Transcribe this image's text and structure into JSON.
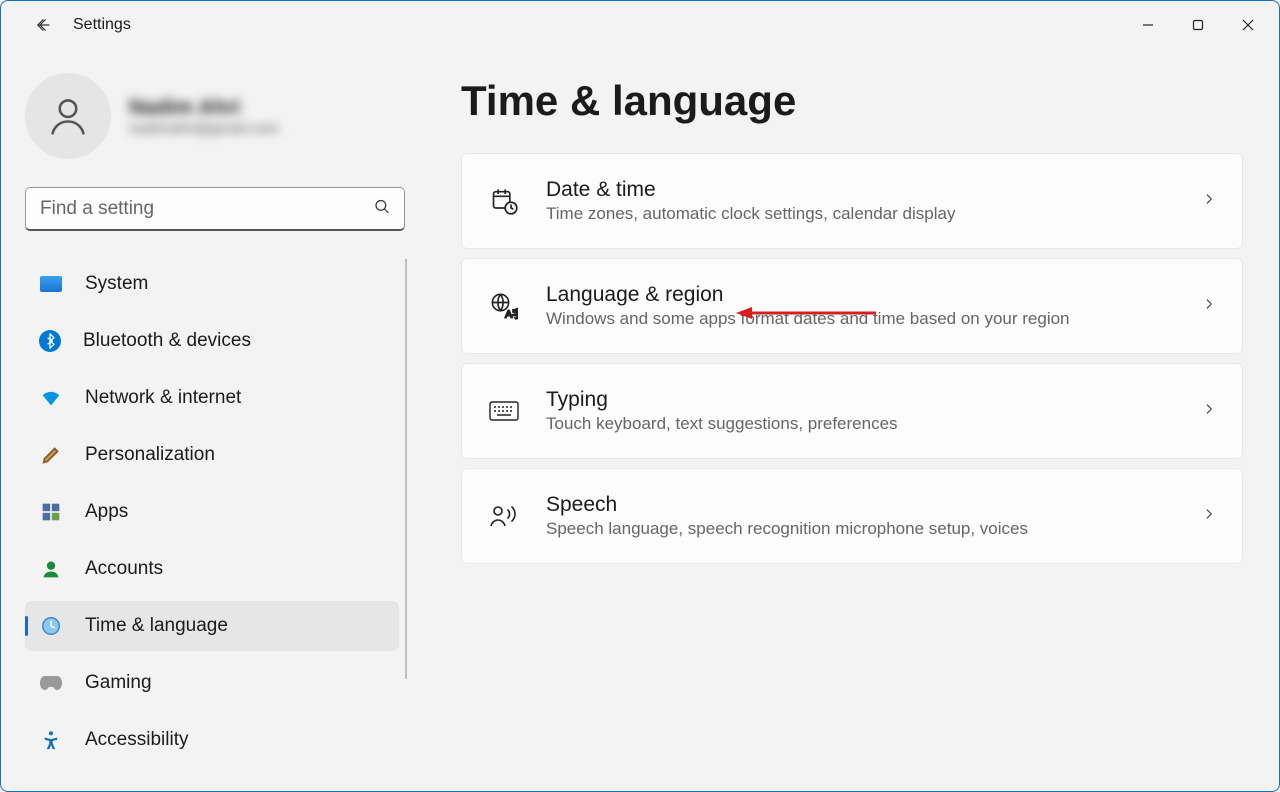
{
  "app_title": "Settings",
  "profile": {
    "name": "Nadim Ahri",
    "email": "nadimahri@gmail.com"
  },
  "search": {
    "placeholder": "Find a setting"
  },
  "nav": {
    "items": [
      {
        "label": "System"
      },
      {
        "label": "Bluetooth & devices"
      },
      {
        "label": "Network & internet"
      },
      {
        "label": "Personalization"
      },
      {
        "label": "Apps"
      },
      {
        "label": "Accounts"
      },
      {
        "label": "Time & language"
      },
      {
        "label": "Gaming"
      },
      {
        "label": "Accessibility"
      }
    ]
  },
  "page": {
    "title": "Time & language"
  },
  "cards": {
    "datetime": {
      "title": "Date & time",
      "desc": "Time zones, automatic clock settings, calendar display"
    },
    "language": {
      "title": "Language & region",
      "desc": "Windows and some apps format dates and time based on your region"
    },
    "typing": {
      "title": "Typing",
      "desc": "Touch keyboard, text suggestions, preferences"
    },
    "speech": {
      "title": "Speech",
      "desc": "Speech language, speech recognition microphone setup, voices"
    }
  }
}
